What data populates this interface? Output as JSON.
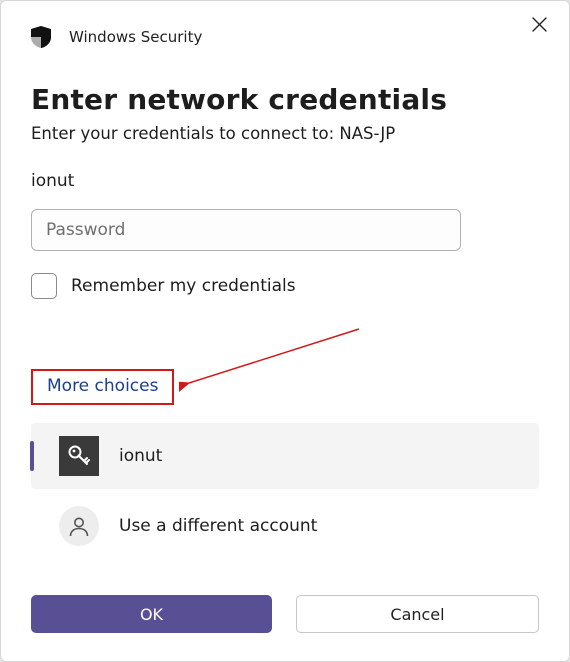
{
  "titlebar": {
    "icon": "shield-icon",
    "text": "Windows Security"
  },
  "heading": "Enter network credentials",
  "subtitle": "Enter your credentials to connect to: NAS-JP",
  "username": "ionut",
  "password": {
    "placeholder": "Password",
    "value": ""
  },
  "remember": {
    "label": "Remember my credentials",
    "checked": false
  },
  "more_choices_label": "More choices",
  "accounts": [
    {
      "icon": "key-icon",
      "label": "ionut",
      "selected": true
    },
    {
      "icon": "person-icon",
      "label": "Use a different account",
      "selected": false
    }
  ],
  "buttons": {
    "ok": "OK",
    "cancel": "Cancel"
  },
  "colors": {
    "accent": "#594f95",
    "highlight_border": "#d21919"
  }
}
